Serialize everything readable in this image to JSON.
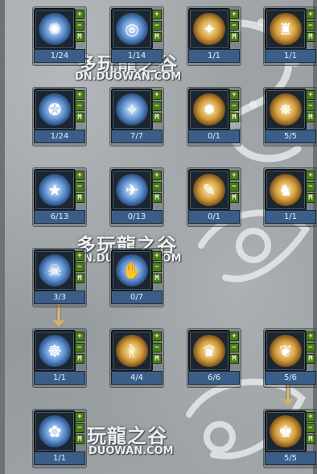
{
  "watermarks": [
    {
      "cn": "多玩龍之谷",
      "url": "DN.DUOWAN.COM"
    },
    {
      "cn": "多玩龍之谷",
      "url": "N.DUOWAN.COM"
    },
    {
      "cn": "玩龍之谷",
      "url": "DUOWAN.COM"
    }
  ],
  "buttons": {
    "plus": "+",
    "minus": "−",
    "max": "M"
  },
  "skills": [
    {
      "level": "1/24",
      "style": "blue",
      "glyph": "✺"
    },
    {
      "level": "1/14",
      "style": "blue",
      "glyph": "◎"
    },
    {
      "level": "1/1",
      "style": "gold",
      "glyph": "✦"
    },
    {
      "level": "1/1",
      "style": "gold",
      "glyph": "♜"
    },
    {
      "level": "1/24",
      "style": "blue",
      "glyph": "✪"
    },
    {
      "level": "7/7",
      "style": "blue",
      "glyph": "✧"
    },
    {
      "level": "0/1",
      "style": "gold",
      "glyph": "✹"
    },
    {
      "level": "5/5",
      "style": "gold",
      "glyph": "✵"
    },
    {
      "level": "6/13",
      "style": "blue",
      "glyph": "★"
    },
    {
      "level": "0/13",
      "style": "blue",
      "glyph": "✈"
    },
    {
      "level": "0/1",
      "style": "gold",
      "glyph": "✎"
    },
    {
      "level": "1/1",
      "style": "gold",
      "glyph": "♞"
    },
    {
      "level": "3/3",
      "style": "blue",
      "glyph": "☠"
    },
    {
      "level": "0/7",
      "style": "blue",
      "glyph": "✋"
    },
    {
      "level": "1/1",
      "style": "blue",
      "glyph": "☸"
    },
    {
      "level": "4/4",
      "style": "gold",
      "glyph": "ᚱ"
    },
    {
      "level": "6/6",
      "style": "gold",
      "glyph": "♛"
    },
    {
      "level": "5/6",
      "style": "gold",
      "glyph": "❦"
    },
    {
      "level": "1/1",
      "style": "blue",
      "glyph": "✿"
    },
    {
      "level": "5/5",
      "style": "gold",
      "glyph": "♚"
    }
  ]
}
